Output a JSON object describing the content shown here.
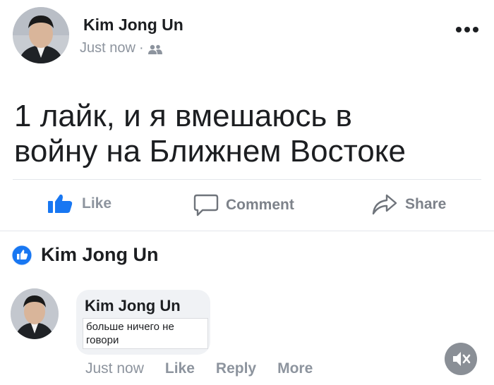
{
  "post": {
    "author": "Kim Jong Un",
    "time": "Just now",
    "separator": "·",
    "audience_icon": "friends-icon",
    "menu_icon": "more-dots-icon",
    "text_line1": "1 лайк, и я вмешаюсь в",
    "text_line2": "войну на Ближнем Востоке"
  },
  "actions": {
    "like": "Like",
    "comment": "Comment",
    "share": "Share"
  },
  "reactions": {
    "icon": "like-reaction-icon",
    "name": "Kim Jong Un"
  },
  "comment": {
    "author": "Kim Jong Un",
    "text": "больше ничего не говори",
    "time": "Just now",
    "like": "Like",
    "reply": "Reply",
    "more": "More"
  },
  "media": {
    "mute_icon": "muted-speaker-icon"
  },
  "colors": {
    "accent": "#1877f2",
    "muted_text": "#8d949e",
    "action_text": "#7d828a",
    "divider": "#e4e6eb",
    "bubble": "#f0f2f5"
  }
}
